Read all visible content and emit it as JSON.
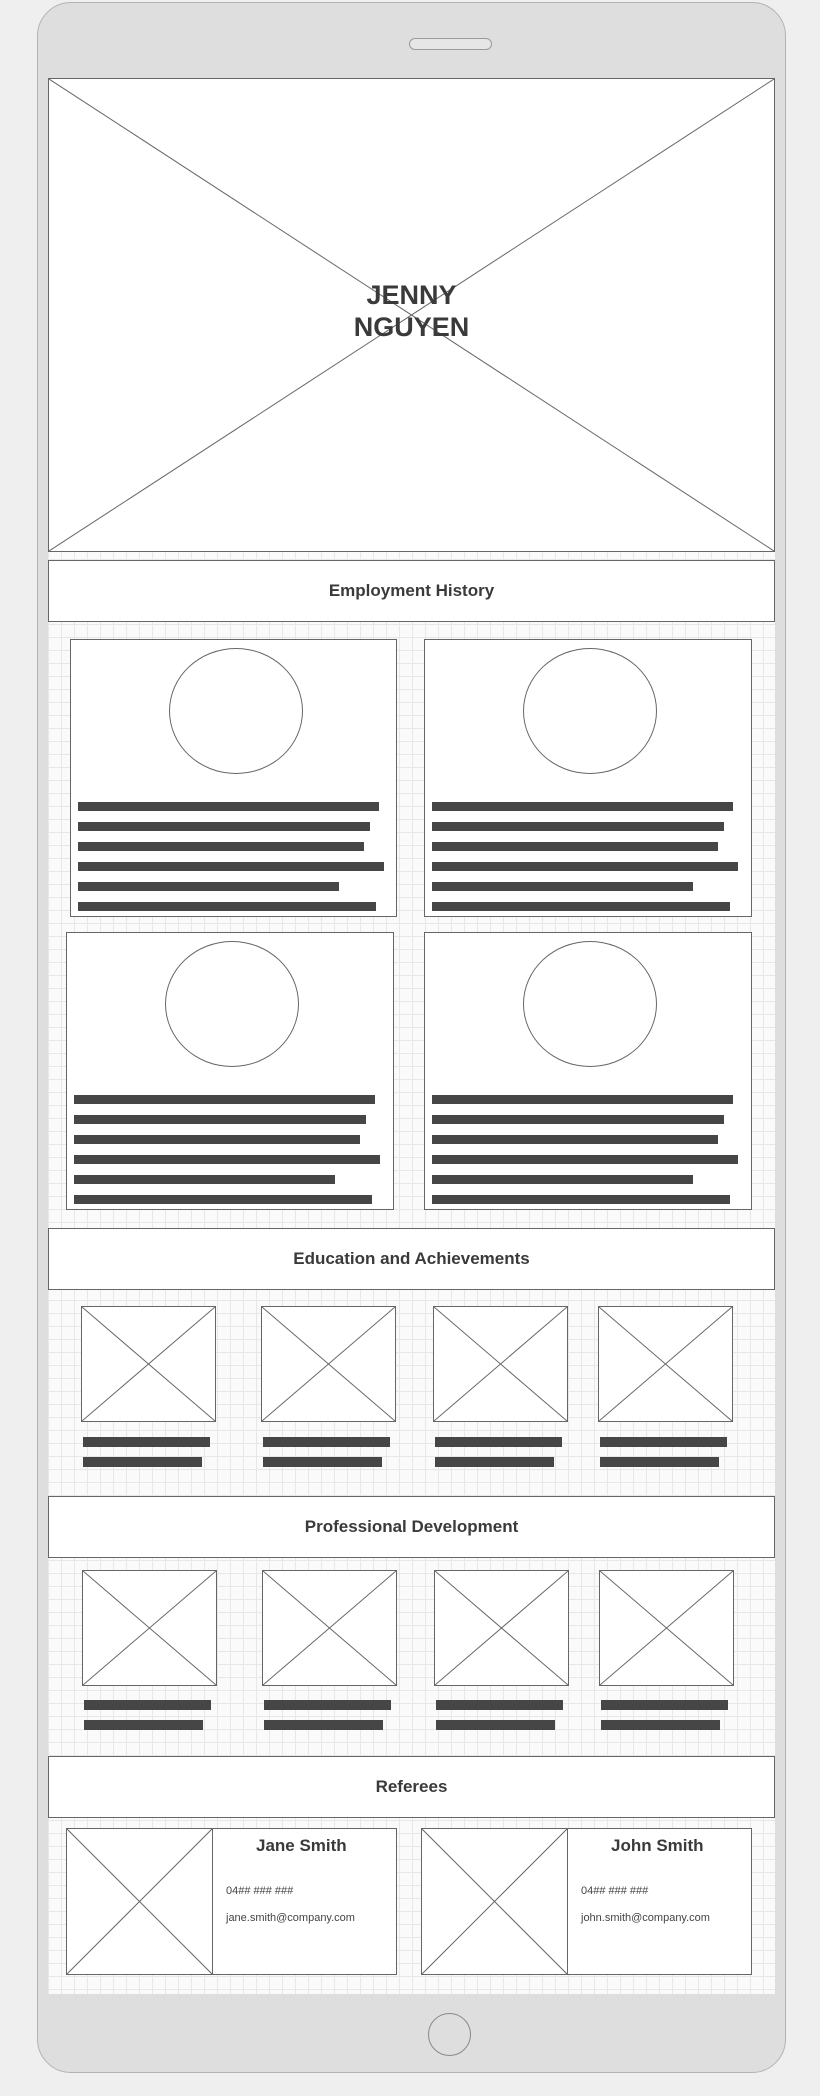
{
  "hero": {
    "name_line1": "JENNY",
    "name_line2": "NGUYEN"
  },
  "sections": {
    "employment": "Employment History",
    "education": "Education and Achievements",
    "development": "Professional Development",
    "referees": "Referees"
  },
  "referees": [
    {
      "name": "Jane Smith",
      "phone": "04## ### ###",
      "email": "jane.smith@company.com"
    },
    {
      "name": "John Smith",
      "phone": "04## ### ###",
      "email": "john.smith@company.com"
    }
  ],
  "colors": {
    "frame": "#dedede",
    "line": "#666666",
    "text_bar": "#464646",
    "background_grid": "#e7e7e7"
  },
  "icons": {
    "home": "home-button",
    "speaker": "speaker-slot",
    "image_placeholder": "image-placeholder-icon"
  }
}
